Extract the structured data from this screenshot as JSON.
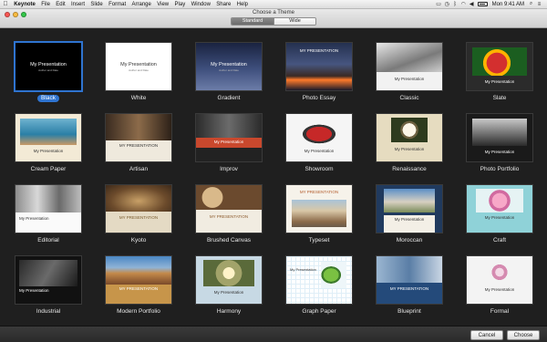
{
  "menubar": {
    "app_name": "Keynote",
    "items": [
      "File",
      "Edit",
      "Insert",
      "Slide",
      "Format",
      "Arrange",
      "View",
      "Play",
      "Window",
      "Share",
      "Help"
    ],
    "time": "Mon 9:41 AM"
  },
  "window": {
    "title": "Choose a Theme",
    "tabs": [
      {
        "label": "Standard",
        "active": true
      },
      {
        "label": "Wide",
        "active": false
      }
    ]
  },
  "themes": [
    {
      "name": "Black",
      "selected": true,
      "thumb_title": "My Presentation",
      "thumb_sub": "Author and Date"
    },
    {
      "name": "White",
      "thumb_title": "My Presentation",
      "thumb_sub": "Author and Date"
    },
    {
      "name": "Gradient",
      "thumb_title": "My Presentation",
      "thumb_sub": "Author and Date"
    },
    {
      "name": "Photo Essay",
      "thumb_title": "MY PRESENTATION",
      "thumb_sub": ""
    },
    {
      "name": "Classic",
      "thumb_title": "My Presentation",
      "thumb_sub": ""
    },
    {
      "name": "Slate",
      "thumb_title": "My Presentation",
      "thumb_sub": ""
    },
    {
      "name": "Cream Paper",
      "thumb_title": "My Presentation",
      "thumb_sub": ""
    },
    {
      "name": "Artisan",
      "thumb_title": "MY PRESENTATION",
      "thumb_sub": ""
    },
    {
      "name": "Improv",
      "thumb_title": "My Presentation",
      "thumb_sub": ""
    },
    {
      "name": "Showroom",
      "thumb_title": "My Presentation",
      "thumb_sub": ""
    },
    {
      "name": "Renaissance",
      "thumb_title": "My Presentation",
      "thumb_sub": ""
    },
    {
      "name": "Photo Portfolio",
      "thumb_title": "My Presentation",
      "thumb_sub": ""
    },
    {
      "name": "Editorial",
      "thumb_title": "My Presentation",
      "thumb_sub": ""
    },
    {
      "name": "Kyoto",
      "thumb_title": "MY PRESENTATION",
      "thumb_sub": ""
    },
    {
      "name": "Brushed Canvas",
      "thumb_title": "MY PRESENTATION",
      "thumb_sub": ""
    },
    {
      "name": "Typeset",
      "thumb_title": "MY PRESENTATION",
      "thumb_sub": ""
    },
    {
      "name": "Moroccan",
      "thumb_title": "My Presentation",
      "thumb_sub": ""
    },
    {
      "name": "Craft",
      "thumb_title": "My Presentation",
      "thumb_sub": ""
    },
    {
      "name": "Industrial",
      "thumb_title": "My Presentation",
      "thumb_sub": ""
    },
    {
      "name": "Modern Portfolio",
      "thumb_title": "MY PRESENTATION",
      "thumb_sub": ""
    },
    {
      "name": "Harmony",
      "thumb_title": "My Presentation",
      "thumb_sub": ""
    },
    {
      "name": "Graph Paper",
      "thumb_title": "My Presentation",
      "thumb_sub": ""
    },
    {
      "name": "Blueprint",
      "thumb_title": "MY PRESENTATION",
      "thumb_sub": ""
    },
    {
      "name": "Formal",
      "thumb_title": "My Presentation",
      "thumb_sub": ""
    }
  ],
  "footer": {
    "cancel_label": "Cancel",
    "choose_label": "Choose"
  },
  "colors": {
    "selection": "#2f74d0",
    "background": "#1f1f1f"
  }
}
